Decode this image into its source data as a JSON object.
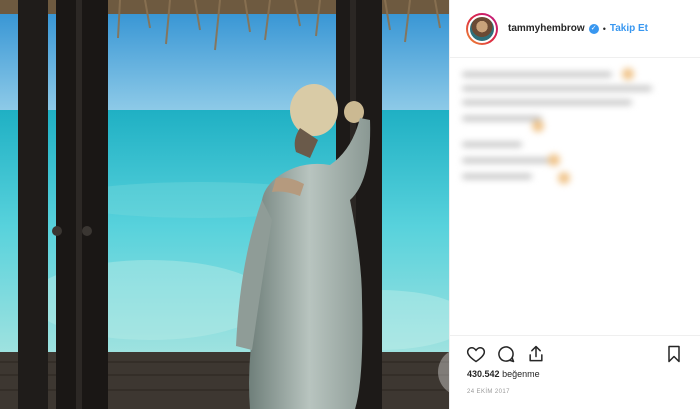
{
  "post": {
    "username": "tammyhembrow",
    "verified_icon": "verified-badge-icon",
    "separator": "•",
    "follow_label": "Takip Et",
    "likes_count": "430.542",
    "likes_word": "beğenme",
    "date": "24 EKİM 2017"
  },
  "icons": {
    "like": "heart-icon",
    "comment": "comment-icon",
    "share": "share-icon",
    "save": "bookmark-icon"
  },
  "colors": {
    "link_blue": "#3897f0",
    "text": "#262626",
    "muted": "#999999",
    "border": "#efefef"
  }
}
